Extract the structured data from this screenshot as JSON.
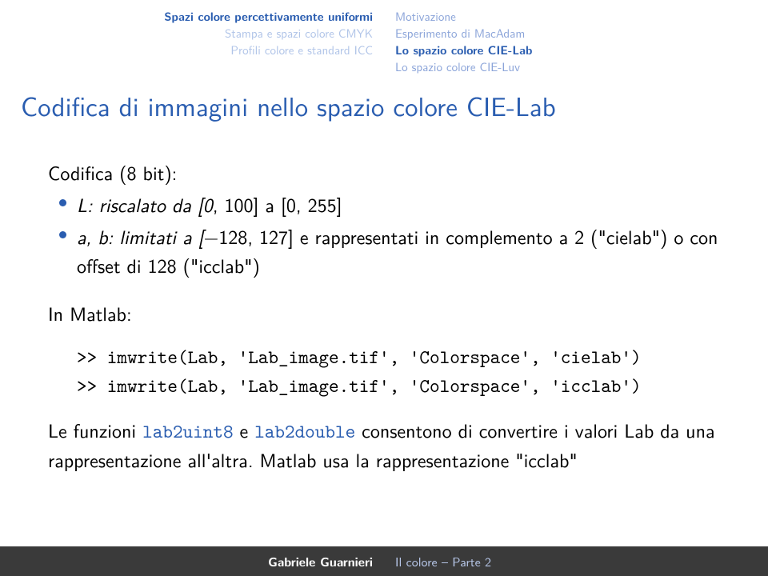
{
  "header": {
    "left": [
      "Spazi colore percettivamente uniformi",
      "Stampa e spazi colore CMYK",
      "Profili colore e standard ICC"
    ],
    "leftActive": 0,
    "right": [
      "Motivazione",
      "Esperimento di MacAdam",
      "Lo spazio colore CIE-Lab",
      "Lo spazio colore CIE-Luv"
    ],
    "rightActive": 2
  },
  "title": "Codifica di immagini nello spazio colore CIE-Lab",
  "lead": "Codifica (8 bit):",
  "bullet1": {
    "pre": "L: riscalato da [0",
    "mid": ", 100] a [0",
    "post": ", 255]"
  },
  "bullet2": {
    "a": "a, b: limitati a [",
    "b": "−",
    "c": "128",
    "d": ", 127] e rappresentati in complemento a 2 (\"cielab\") o con offset di 128 (\"icclab\")"
  },
  "inmatlab": "In Matlab:",
  "code1": ">> imwrite(Lab, 'Lab_image.tif', 'Colorspace', 'cielab')",
  "code2": ">> imwrite(Lab, 'Lab_image.tif', 'Colorspace', 'icclab')",
  "para": {
    "a": "Le funzioni ",
    "f1": "lab2uint8",
    "b": " e ",
    "f2": "lab2double",
    "c": " consentono di convertire i valori Lab da una rappresentazione all'altra. Matlab usa la rappresentazione \"icclab\""
  },
  "footer": {
    "author": "Gabriele Guarnieri",
    "title": "Il colore – Parte 2"
  }
}
